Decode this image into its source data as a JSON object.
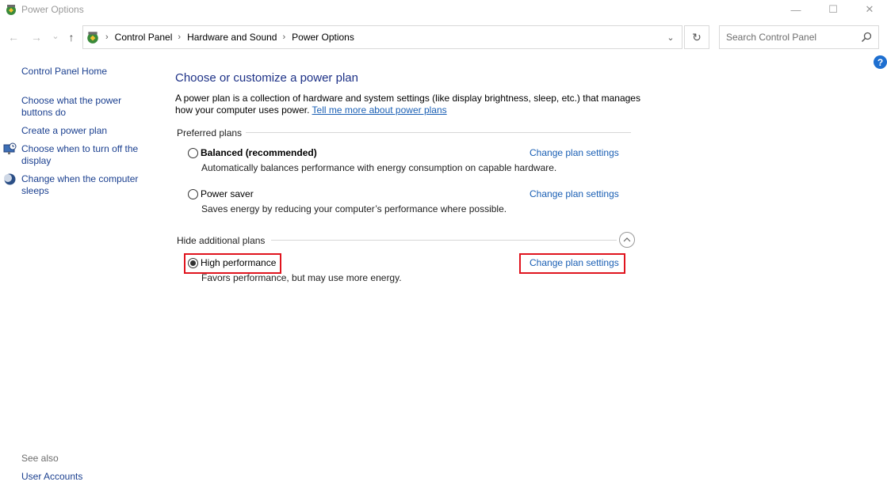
{
  "window": {
    "title": "Power Options",
    "minimize_glyph": "—",
    "maximize_glyph": "☐",
    "close_glyph": "✕"
  },
  "nav": {
    "back_glyph": "←",
    "forward_glyph": "→",
    "recent_glyph": "⌄",
    "up_glyph": "↑",
    "breadcrumb": [
      "Control Panel",
      "Hardware and Sound",
      "Power Options"
    ],
    "separator": "›",
    "dropdown_glyph": "⌄",
    "refresh_glyph": "↻",
    "search_placeholder": "Search Control Panel"
  },
  "help_glyph": "?",
  "sidebar": {
    "home": "Control Panel Home",
    "items": [
      {
        "label": "Choose what the power buttons do",
        "icon": "none"
      },
      {
        "label": "Create a power plan",
        "icon": "none"
      },
      {
        "label": "Choose when to turn off the display",
        "icon": "display-clock-icon"
      },
      {
        "label": "Change when the computer sleeps",
        "icon": "moon-icon"
      }
    ],
    "see_also": "See also",
    "user_accounts": "User Accounts"
  },
  "main": {
    "heading": "Choose or customize a power plan",
    "description": "A power plan is a collection of hardware and system settings (like display brightness, sleep, etc.) that manages how your computer uses power.",
    "learn_more": "Tell me more about power plans",
    "preferred_label": "Preferred plans",
    "additional_label": "Hide additional plans",
    "plans": [
      {
        "name": "Balanced (recommended)",
        "description": "Automatically balances performance with energy consumption on capable hardware.",
        "link": "Change plan settings",
        "selected": false
      },
      {
        "name": "Power saver",
        "description": "Saves energy by reducing your computer’s performance where possible.",
        "link": "Change plan settings",
        "selected": false
      },
      {
        "name": "High performance",
        "description": "Favors performance, but may use more energy.",
        "link": "Change plan settings",
        "selected": true
      }
    ]
  },
  "colors": {
    "link": "#1a5fb4",
    "heading": "#1e3287",
    "highlight": "#e0141e"
  }
}
